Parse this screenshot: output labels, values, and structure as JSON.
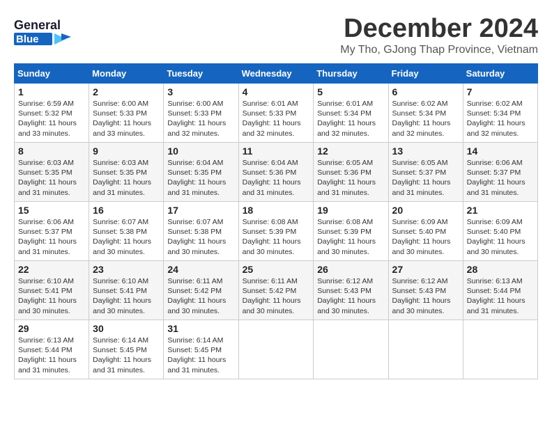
{
  "header": {
    "logo_line1": "General",
    "logo_line2": "Blue",
    "month_title": "December 2024",
    "location": "My Tho, GJong Thap Province, Vietnam"
  },
  "weekdays": [
    "Sunday",
    "Monday",
    "Tuesday",
    "Wednesday",
    "Thursday",
    "Friday",
    "Saturday"
  ],
  "weeks": [
    [
      {
        "day": "1",
        "sunrise": "6:59 AM",
        "sunset": "5:32 PM",
        "daylight": "11 hours and 33 minutes."
      },
      {
        "day": "2",
        "sunrise": "6:00 AM",
        "sunset": "5:33 PM",
        "daylight": "11 hours and 33 minutes."
      },
      {
        "day": "3",
        "sunrise": "6:00 AM",
        "sunset": "5:33 PM",
        "daylight": "11 hours and 32 minutes."
      },
      {
        "day": "4",
        "sunrise": "6:01 AM",
        "sunset": "5:33 PM",
        "daylight": "11 hours and 32 minutes."
      },
      {
        "day": "5",
        "sunrise": "6:01 AM",
        "sunset": "5:34 PM",
        "daylight": "11 hours and 32 minutes."
      },
      {
        "day": "6",
        "sunrise": "6:02 AM",
        "sunset": "5:34 PM",
        "daylight": "11 hours and 32 minutes."
      },
      {
        "day": "7",
        "sunrise": "6:02 AM",
        "sunset": "5:34 PM",
        "daylight": "11 hours and 32 minutes."
      }
    ],
    [
      {
        "day": "8",
        "sunrise": "6:03 AM",
        "sunset": "5:35 PM",
        "daylight": "11 hours and 31 minutes."
      },
      {
        "day": "9",
        "sunrise": "6:03 AM",
        "sunset": "5:35 PM",
        "daylight": "11 hours and 31 minutes."
      },
      {
        "day": "10",
        "sunrise": "6:04 AM",
        "sunset": "5:35 PM",
        "daylight": "11 hours and 31 minutes."
      },
      {
        "day": "11",
        "sunrise": "6:04 AM",
        "sunset": "5:36 PM",
        "daylight": "11 hours and 31 minutes."
      },
      {
        "day": "12",
        "sunrise": "6:05 AM",
        "sunset": "5:36 PM",
        "daylight": "11 hours and 31 minutes."
      },
      {
        "day": "13",
        "sunrise": "6:05 AM",
        "sunset": "5:37 PM",
        "daylight": "11 hours and 31 minutes."
      },
      {
        "day": "14",
        "sunrise": "6:06 AM",
        "sunset": "5:37 PM",
        "daylight": "11 hours and 31 minutes."
      }
    ],
    [
      {
        "day": "15",
        "sunrise": "6:06 AM",
        "sunset": "5:37 PM",
        "daylight": "11 hours and 31 minutes."
      },
      {
        "day": "16",
        "sunrise": "6:07 AM",
        "sunset": "5:38 PM",
        "daylight": "11 hours and 30 minutes."
      },
      {
        "day": "17",
        "sunrise": "6:07 AM",
        "sunset": "5:38 PM",
        "daylight": "11 hours and 30 minutes."
      },
      {
        "day": "18",
        "sunrise": "6:08 AM",
        "sunset": "5:39 PM",
        "daylight": "11 hours and 30 minutes."
      },
      {
        "day": "19",
        "sunrise": "6:08 AM",
        "sunset": "5:39 PM",
        "daylight": "11 hours and 30 minutes."
      },
      {
        "day": "20",
        "sunrise": "6:09 AM",
        "sunset": "5:40 PM",
        "daylight": "11 hours and 30 minutes."
      },
      {
        "day": "21",
        "sunrise": "6:09 AM",
        "sunset": "5:40 PM",
        "daylight": "11 hours and 30 minutes."
      }
    ],
    [
      {
        "day": "22",
        "sunrise": "6:10 AM",
        "sunset": "5:41 PM",
        "daylight": "11 hours and 30 minutes."
      },
      {
        "day": "23",
        "sunrise": "6:10 AM",
        "sunset": "5:41 PM",
        "daylight": "11 hours and 30 minutes."
      },
      {
        "day": "24",
        "sunrise": "6:11 AM",
        "sunset": "5:42 PM",
        "daylight": "11 hours and 30 minutes."
      },
      {
        "day": "25",
        "sunrise": "6:11 AM",
        "sunset": "5:42 PM",
        "daylight": "11 hours and 30 minutes."
      },
      {
        "day": "26",
        "sunrise": "6:12 AM",
        "sunset": "5:43 PM",
        "daylight": "11 hours and 30 minutes."
      },
      {
        "day": "27",
        "sunrise": "6:12 AM",
        "sunset": "5:43 PM",
        "daylight": "11 hours and 30 minutes."
      },
      {
        "day": "28",
        "sunrise": "6:13 AM",
        "sunset": "5:44 PM",
        "daylight": "11 hours and 31 minutes."
      }
    ],
    [
      {
        "day": "29",
        "sunrise": "6:13 AM",
        "sunset": "5:44 PM",
        "daylight": "11 hours and 31 minutes."
      },
      {
        "day": "30",
        "sunrise": "6:14 AM",
        "sunset": "5:45 PM",
        "daylight": "11 hours and 31 minutes."
      },
      {
        "day": "31",
        "sunrise": "6:14 AM",
        "sunset": "5:45 PM",
        "daylight": "11 hours and 31 minutes."
      },
      null,
      null,
      null,
      null
    ]
  ]
}
